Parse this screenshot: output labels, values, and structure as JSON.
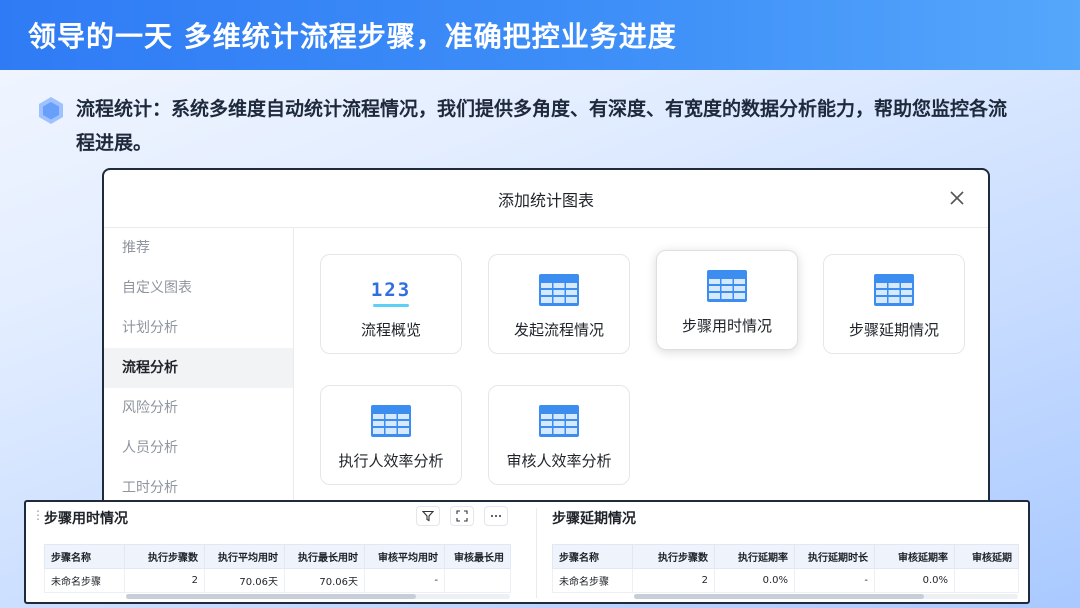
{
  "slide": {
    "title": "领导的一天 多维统计流程步骤，准确把控业务进度",
    "intro": "流程统计：系统多维度自动统计流程情况，我们提供多角度、有深度、有宽度的数据分析能力，帮助您监控各流程进展。"
  },
  "modal": {
    "title": "添加统计图表",
    "close_icon": "close-icon",
    "nav": [
      {
        "label": "推荐"
      },
      {
        "label": "自定义图表"
      },
      {
        "label": "计划分析"
      },
      {
        "label": "流程分析",
        "active": true
      },
      {
        "label": "风险分析"
      },
      {
        "label": "人员分析"
      },
      {
        "label": "工时分析"
      }
    ],
    "cards": [
      {
        "label": "流程概览",
        "icon": "number-icon",
        "icon_text": "123"
      },
      {
        "label": "发起流程情况",
        "icon": "table-icon"
      },
      {
        "label": "步骤用时情况",
        "icon": "table-icon",
        "highlight": true
      },
      {
        "label": "步骤延期情况",
        "icon": "table-icon"
      },
      {
        "label": "执行人效率分析",
        "icon": "table-icon"
      },
      {
        "label": "审核人效率分析",
        "icon": "table-icon"
      }
    ]
  },
  "panels": {
    "left": {
      "title": "步骤用时情况",
      "columns": [
        "步骤名称",
        "执行步骤数",
        "执行平均用时",
        "执行最长用时",
        "审核平均用时",
        "审核最长用"
      ],
      "rows": [
        [
          "未命名步骤",
          "2",
          "70.06天",
          "70.06天",
          "-",
          ""
        ]
      ]
    },
    "right": {
      "title": "步骤延期情况",
      "columns": [
        "步骤名称",
        "执行步骤数",
        "执行延期率",
        "执行延期时长",
        "审核延期率",
        "审核延期"
      ],
      "rows": [
        [
          "未命名步骤",
          "2",
          "0.0%",
          "-",
          "0.0%",
          ""
        ]
      ]
    }
  },
  "colors": {
    "header": "#2f7bf5",
    "accent": "#2f6fe0",
    "table_icon": "#3b8df0"
  }
}
